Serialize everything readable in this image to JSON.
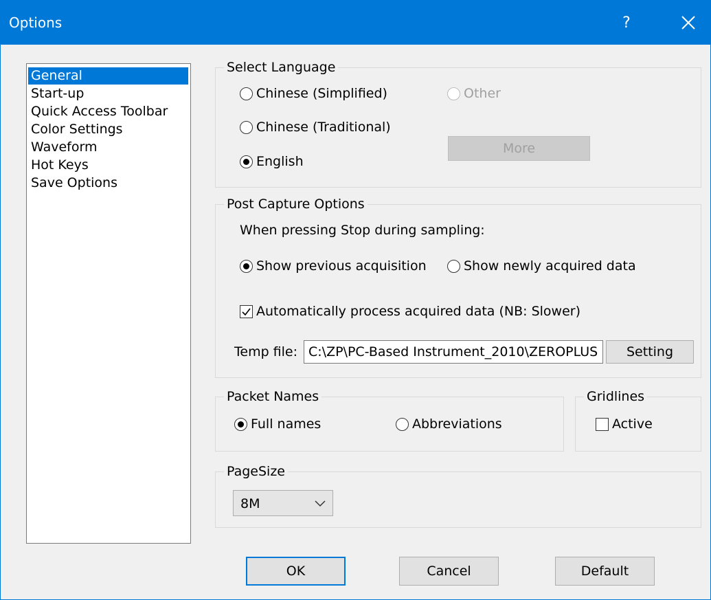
{
  "window": {
    "title": "Options",
    "help_glyph": "?",
    "icons": {
      "close": "close-icon"
    }
  },
  "nav": {
    "items": [
      {
        "label": "General",
        "selected": true
      },
      {
        "label": "Start-up",
        "selected": false
      },
      {
        "label": "Quick Access Toolbar",
        "selected": false
      },
      {
        "label": "Color Settings",
        "selected": false
      },
      {
        "label": "Waveform",
        "selected": false
      },
      {
        "label": "Hot Keys",
        "selected": false
      },
      {
        "label": "Save Options",
        "selected": false
      }
    ]
  },
  "language": {
    "legend": "Select Language",
    "chinese_simplified": "Chinese (Simplified)",
    "chinese_traditional": "Chinese (Traditional)",
    "english": "English",
    "other": "Other",
    "selected": "English",
    "more_label": "More"
  },
  "post_capture": {
    "legend": "Post Capture Options",
    "prompt": "When pressing Stop during sampling:",
    "show_previous": "Show previous acquisition",
    "show_new": "Show newly acquired data",
    "selected": "Show previous acquisition",
    "auto_process": "Automatically process acquired data (NB: Slower)",
    "auto_process_checked": true,
    "temp_label": "Temp file:",
    "temp_value": "C:\\ZP\\PC-Based Instrument_2010\\ZEROPLUS",
    "setting_label": "Setting"
  },
  "packet_names": {
    "legend": "Packet Names",
    "full": "Full names",
    "abbrev": "Abbreviations",
    "selected": "Full names"
  },
  "gridlines": {
    "legend": "Gridlines",
    "active_label": "Active",
    "active_checked": false
  },
  "page_size": {
    "legend": "PageSize",
    "value": "8M"
  },
  "buttons": {
    "ok": "OK",
    "cancel": "Cancel",
    "default": "Default"
  },
  "colors": {
    "accent": "#0078d7",
    "dialog_bg": "#f0f0f0",
    "button_bg": "#e1e1e1"
  }
}
